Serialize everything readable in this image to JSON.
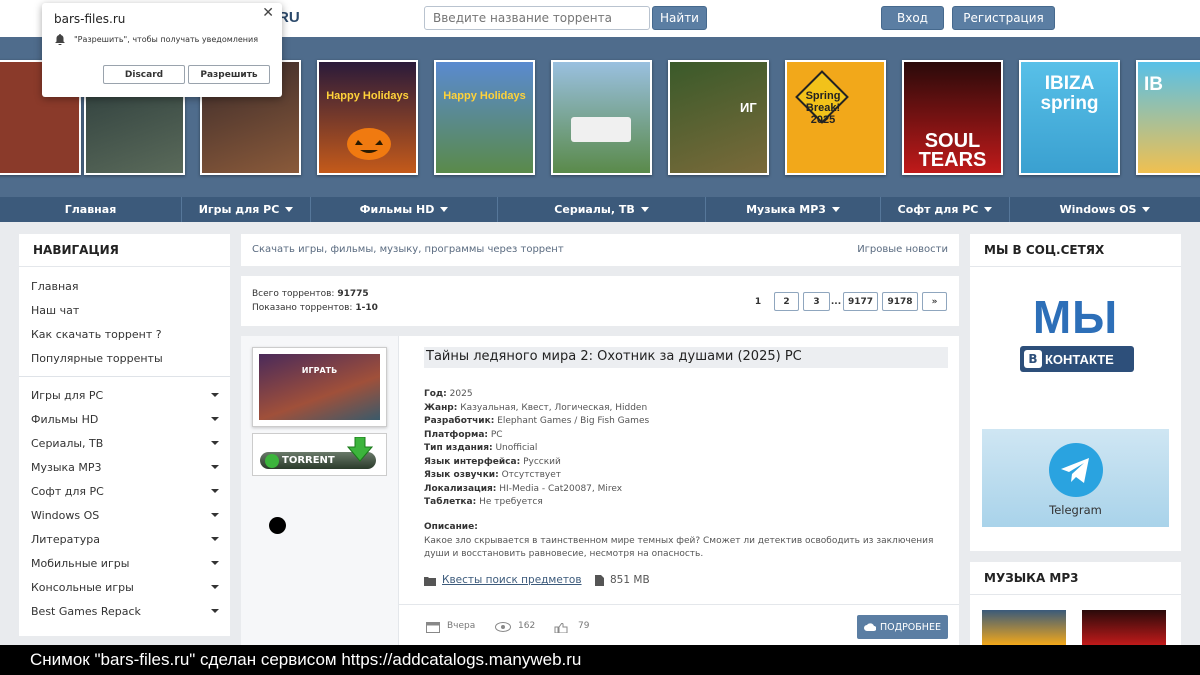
{
  "header": {
    "logo_suffix": "RU",
    "search_placeholder": "Введите название торрента",
    "find_label": "Найти",
    "login_label": "Вход",
    "register_label": "Регистрация"
  },
  "notification": {
    "site": "bars-files.ru",
    "message": "\"Разрешить\", чтобы получать уведомления",
    "discard_label": "Discard",
    "allow_label": "Разрешить",
    "close_glyph": "✕"
  },
  "covers": [
    {
      "text": "",
      "bg": "#8a3a2a"
    },
    {
      "text": "",
      "bg": "#3d4a4a"
    },
    {
      "text": "",
      "bg": "#6a4a3a"
    },
    {
      "text": "Happy Holidays",
      "bg": "#c45a1a"
    },
    {
      "text": "Happy Holidays",
      "bg": "#3a6a9a"
    },
    {
      "text": "",
      "bg": "#5a8a4a"
    },
    {
      "text": "ИГ",
      "bg": "#4a6a3a"
    },
    {
      "text": "Spring Break! 2025",
      "bg": "#f2a81a"
    },
    {
      "text": "SOUL TEARS",
      "bg": "#1a1a1a"
    },
    {
      "text": "IBIZA spring",
      "bg": "#4ab0d8"
    },
    {
      "text": "IB",
      "bg": "#4ab0d8"
    }
  ],
  "nav": [
    {
      "label": "Главная",
      "caret": false
    },
    {
      "label": "Игры для PC",
      "caret": true
    },
    {
      "label": "Фильмы HD",
      "caret": true
    },
    {
      "label": "Сериалы, ТВ",
      "caret": true
    },
    {
      "label": "Музыка MP3",
      "caret": true
    },
    {
      "label": "Софт для PC",
      "caret": true
    },
    {
      "label": "Windows OS",
      "caret": true
    }
  ],
  "sidebar": {
    "title": "НАВИГАЦИЯ",
    "links": [
      "Главная",
      "Наш чат",
      "Как скачать торрент ?",
      "Популярные торренты"
    ],
    "categories": [
      "Игры для PC",
      "Фильмы HD",
      "Сериалы, ТВ",
      "Музыка MP3",
      "Софт для PC",
      "Windows OS",
      "Литература",
      "Мобильные игры",
      "Консольные игры",
      "Best Games Repack"
    ]
  },
  "crumbs": {
    "left": "Скачать игры, фильмы, музыку, программы через торрент",
    "right": "Игровые новости"
  },
  "stats": {
    "total_label": "Всего торрентов:",
    "total_value": "91775",
    "shown_label": "Показано торрентов:",
    "shown_value": "1-10",
    "pages": [
      "1",
      "2",
      "3",
      "...",
      "9177",
      "9178",
      "»"
    ]
  },
  "post": {
    "title": "Тайны ледяного мира 2: Охотник за душами (2025) PC",
    "cover_label": "ИГРАТЬ",
    "torrent_label": "TORRENT",
    "meta": [
      {
        "k": "Год:",
        "v": "2025"
      },
      {
        "k": "Жанр:",
        "v": "Казуальная, Квест, Логическая, Hidden"
      },
      {
        "k": "Разработчик:",
        "v": "Elephant Games / Big Fish Games"
      },
      {
        "k": "Платформа:",
        "v": "PC"
      },
      {
        "k": "Тип издания:",
        "v": "Unofficial"
      },
      {
        "k": "Язык интерфейса:",
        "v": "Русский"
      },
      {
        "k": "Язык озвучки:",
        "v": "Отсутствует"
      },
      {
        "k": "Локализация:",
        "v": "HI-Media - Cat20087, Mirex"
      },
      {
        "k": "Таблетка:",
        "v": "Не требуется"
      }
    ],
    "desc_label": "Описание:",
    "desc_text": "Какое зло скрывается в таинственном мире темных фей? Сможет ли детектив освободить из заключения души и восстановить равновесие, несмотря на опасность.",
    "category_link": "Квесты поиск предметов",
    "size": "851 MB",
    "date": "Вчера",
    "views": "162",
    "likes": "79",
    "more_label": "ПОДРОБНЕЕ"
  },
  "social": {
    "title": "МЫ В СОЦ.СЕТЯХ",
    "vk_big": "МЫ",
    "vk_small": "КОНТАКТЕ",
    "vk_letter": "В",
    "telegram": "Telegram"
  },
  "music": {
    "title": "МУЗЫКА MP3"
  },
  "caption": "Снимок \"bars-files.ru\" сделан сервисом https://addcatalogs.manyweb.ru"
}
